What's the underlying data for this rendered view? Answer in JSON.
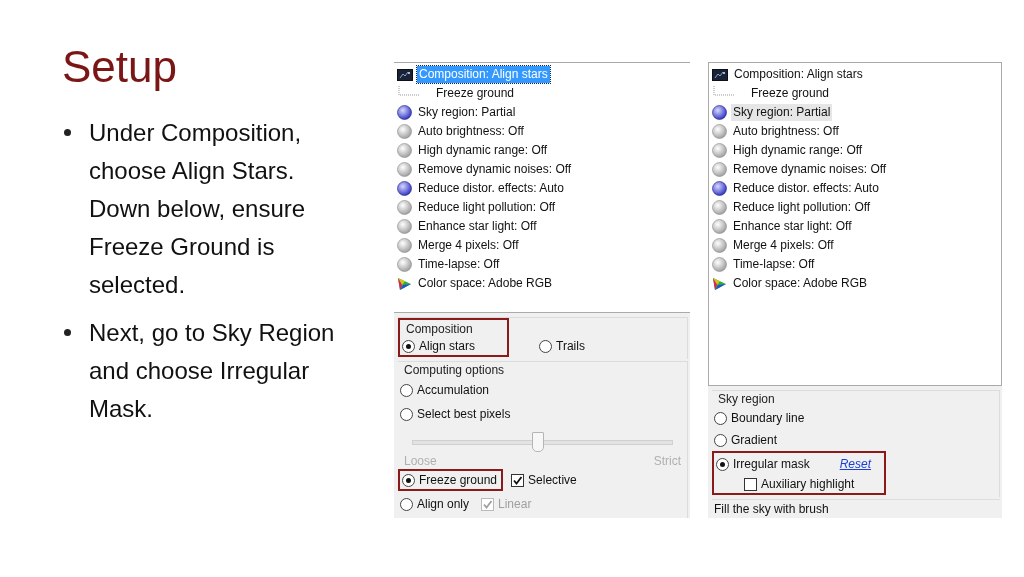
{
  "slide": {
    "title": "Setup",
    "bullets": [
      "Under Composition, choose Align Stars. Down below, ensure Freeze Ground is selected.",
      "Next, go to Sky Region and choose Irregular Mask."
    ]
  },
  "panels": [
    {
      "focused": true,
      "tree": [
        {
          "kind": "composition",
          "label": "Composition: Align stars",
          "selected": true,
          "children": [
            {
              "label": "Freeze ground",
              "selected": false
            }
          ]
        },
        {
          "kind": "dot",
          "label": "Sky region: Partial",
          "on": true,
          "selected": false
        },
        {
          "kind": "dot",
          "label": "Auto brightness: Off",
          "on": false,
          "selected": false
        },
        {
          "kind": "dot",
          "label": "High dynamic range: Off",
          "on": false,
          "selected": false
        },
        {
          "kind": "dot",
          "label": "Remove dynamic noises: Off",
          "on": false,
          "selected": false
        },
        {
          "kind": "dot",
          "label": "Reduce distor. effects: Auto",
          "on": true,
          "selected": false
        },
        {
          "kind": "dot",
          "label": "Reduce light pollution: Off",
          "on": false,
          "selected": false
        },
        {
          "kind": "dot",
          "label": "Enhance star light: Off",
          "on": false,
          "selected": false
        },
        {
          "kind": "dot",
          "label": "Merge 4 pixels: Off",
          "on": false,
          "selected": false
        },
        {
          "kind": "dot",
          "label": "Time-lapse: Off",
          "on": false,
          "selected": false
        },
        {
          "kind": "colorspace",
          "label": "Color space: Adobe RGB",
          "selected": false
        }
      ],
      "groups": [
        {
          "legend": "Composition",
          "marked": true,
          "rows": [
            {
              "controls": [
                {
                  "kind": "radio",
                  "label": "Align stars",
                  "selected": true
                },
                {
                  "kind": "radio",
                  "label": "Trails",
                  "selected": false
                }
              ]
            }
          ]
        },
        {
          "legend": "Computing options",
          "marked": false,
          "rows": [
            {
              "controls": [
                {
                  "kind": "radio",
                  "label": "Accumulation",
                  "selected": false
                }
              ]
            },
            {
              "controls": [
                {
                  "kind": "radio",
                  "label": "Select best pixels",
                  "selected": false
                }
              ]
            },
            {
              "controls": [
                {
                  "kind": "slider",
                  "level": 0.48,
                  "disabled": true,
                  "min_label": "Loose",
                  "max_label": "Strict"
                }
              ]
            },
            {
              "controls": [
                {
                  "kind": "radio",
                  "label": "Freeze ground",
                  "selected": true,
                  "marked": true
                },
                {
                  "kind": "checkbox",
                  "label": "Selective",
                  "checked": true,
                  "disabled": false
                }
              ]
            },
            {
              "controls": [
                {
                  "kind": "radio",
                  "label": "Align only",
                  "selected": false
                },
                {
                  "kind": "checkbox",
                  "label": "Linear",
                  "checked": true,
                  "disabled": true
                }
              ]
            }
          ]
        }
      ]
    },
    {
      "focused": false,
      "tree": [
        {
          "kind": "composition",
          "label": "Composition: Align stars",
          "selected": false,
          "children": [
            {
              "label": "Freeze ground",
              "selected": false
            }
          ]
        },
        {
          "kind": "dot",
          "label": "Sky region: Partial",
          "on": true,
          "selected": true
        },
        {
          "kind": "dot",
          "label": "Auto brightness: Off",
          "on": false,
          "selected": false
        },
        {
          "kind": "dot",
          "label": "High dynamic range: Off",
          "on": false,
          "selected": false
        },
        {
          "kind": "dot",
          "label": "Remove dynamic noises: Off",
          "on": false,
          "selected": false
        },
        {
          "kind": "dot",
          "label": "Reduce distor. effects: Auto",
          "on": true,
          "selected": false
        },
        {
          "kind": "dot",
          "label": "Reduce light pollution: Off",
          "on": false,
          "selected": false
        },
        {
          "kind": "dot",
          "label": "Enhance star light: Off",
          "on": false,
          "selected": false
        },
        {
          "kind": "dot",
          "label": "Merge 4 pixels: Off",
          "on": false,
          "selected": false
        },
        {
          "kind": "dot",
          "label": "Time-lapse: Off",
          "on": false,
          "selected": false
        },
        {
          "kind": "colorspace",
          "label": "Color space: Adobe RGB",
          "selected": false
        }
      ],
      "groups": [
        {
          "legend": "Sky region",
          "marked": false,
          "rows": [
            {
              "controls": [
                {
                  "kind": "radio",
                  "label": "Boundary line",
                  "selected": false
                }
              ]
            },
            {
              "controls": [
                {
                  "kind": "radio",
                  "label": "Gradient",
                  "selected": false
                }
              ]
            },
            {
              "marked": true,
              "controls": [
                {
                  "kind": "radio",
                  "label": "Irregular mask",
                  "selected": true
                },
                {
                  "kind": "link",
                  "label": "Reset"
                }
              ],
              "sub": [
                {
                  "kind": "checkbox",
                  "label": "Auxiliary highlight",
                  "checked": false,
                  "disabled": false
                }
              ]
            }
          ]
        }
      ],
      "footer": "Fill the sky with brush"
    }
  ]
}
